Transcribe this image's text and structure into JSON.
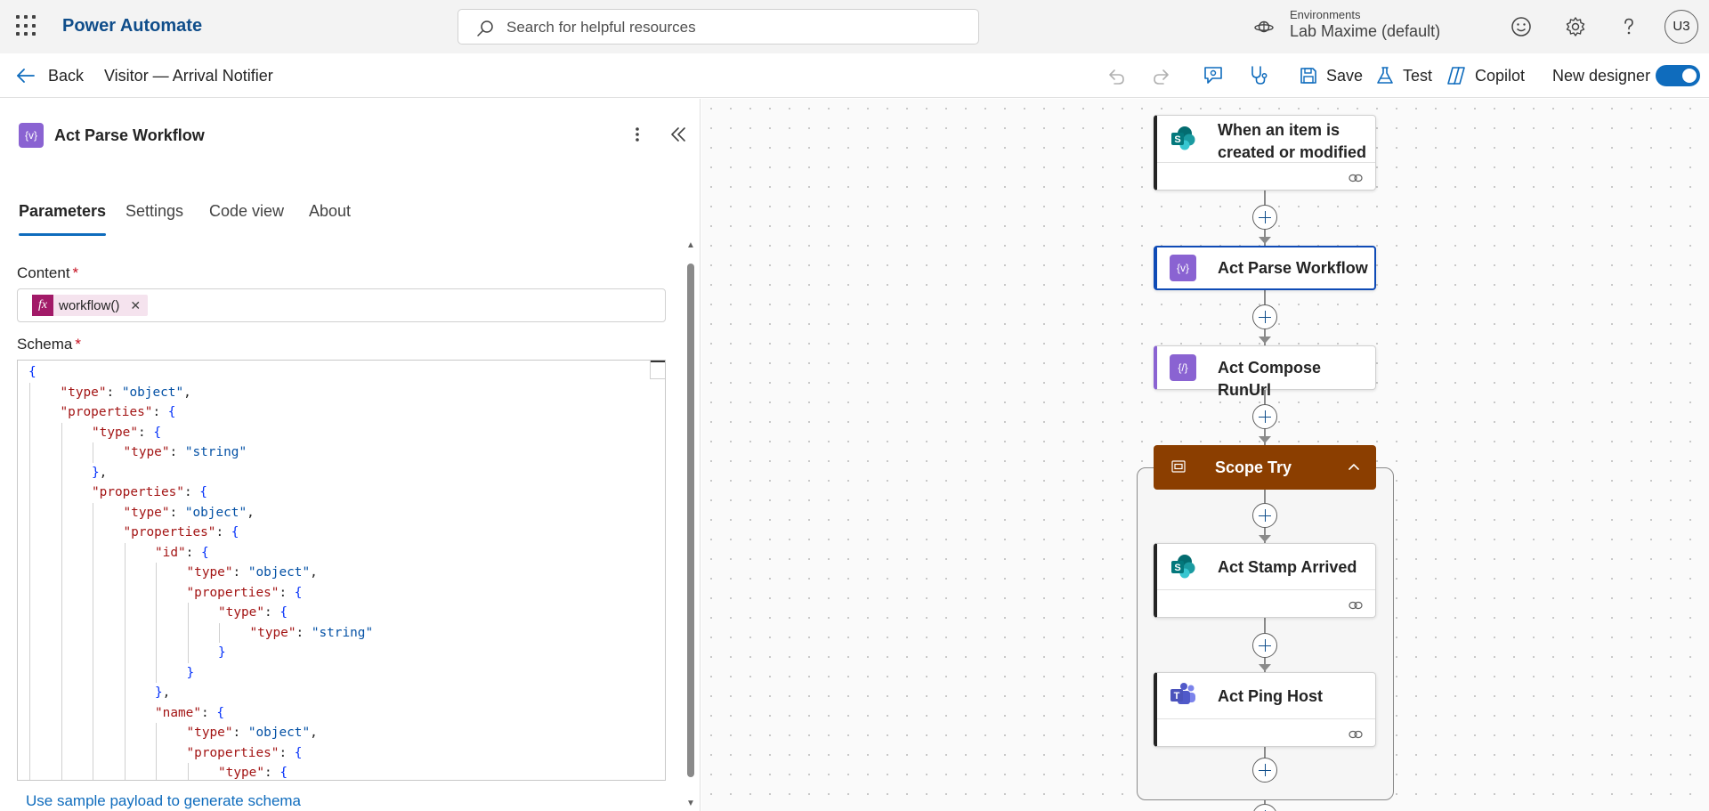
{
  "app": {
    "brand": "Power Automate"
  },
  "search": {
    "placeholder": "Search for helpful resources"
  },
  "environment": {
    "label": "Environments",
    "name": "Lab Maxime (default)"
  },
  "user": {
    "initials": "U3"
  },
  "toolbar": {
    "back_label": "Back",
    "flow_name": "Visitor — Arrival Notifier",
    "save_label": "Save",
    "test_label": "Test",
    "copilot_label": "Copilot",
    "new_designer_label": "New designer",
    "new_designer_on": true
  },
  "panel": {
    "title": "Act Parse Workflow",
    "action_icon": "variable-braces-icon",
    "tabs": [
      {
        "label": "Parameters",
        "active": true
      },
      {
        "label": "Settings",
        "active": false
      },
      {
        "label": "Code view",
        "active": false
      },
      {
        "label": "About",
        "active": false
      }
    ],
    "content_label": "Content",
    "content_required": "*",
    "content_token": "workflow()",
    "schema_label": "Schema",
    "schema_required": "*",
    "schema_lines": [
      {
        "indent": 0,
        "parts": [
          [
            "b",
            "{"
          ]
        ]
      },
      {
        "indent": 1,
        "parts": [
          [
            "k",
            "\"type\""
          ],
          [
            "p",
            ": "
          ],
          [
            "s",
            "\"object\""
          ],
          [
            "p",
            ","
          ]
        ]
      },
      {
        "indent": 1,
        "parts": [
          [
            "k",
            "\"properties\""
          ],
          [
            "p",
            ": "
          ],
          [
            "b",
            "{"
          ]
        ]
      },
      {
        "indent": 2,
        "parts": [
          [
            "k",
            "\"type\""
          ],
          [
            "p",
            ": "
          ],
          [
            "b",
            "{"
          ]
        ]
      },
      {
        "indent": 3,
        "parts": [
          [
            "k",
            "\"type\""
          ],
          [
            "p",
            ": "
          ],
          [
            "s",
            "\"string\""
          ]
        ]
      },
      {
        "indent": 2,
        "parts": [
          [
            "b",
            "}"
          ],
          [
            "p",
            ","
          ]
        ]
      },
      {
        "indent": 2,
        "parts": [
          [
            "k",
            "\"properties\""
          ],
          [
            "p",
            ": "
          ],
          [
            "b",
            "{"
          ]
        ]
      },
      {
        "indent": 3,
        "parts": [
          [
            "k",
            "\"type\""
          ],
          [
            "p",
            ": "
          ],
          [
            "s",
            "\"object\""
          ],
          [
            "p",
            ","
          ]
        ]
      },
      {
        "indent": 3,
        "parts": [
          [
            "k",
            "\"properties\""
          ],
          [
            "p",
            ": "
          ],
          [
            "b",
            "{"
          ]
        ]
      },
      {
        "indent": 4,
        "parts": [
          [
            "k",
            "\"id\""
          ],
          [
            "p",
            ": "
          ],
          [
            "b",
            "{"
          ]
        ]
      },
      {
        "indent": 5,
        "parts": [
          [
            "k",
            "\"type\""
          ],
          [
            "p",
            ": "
          ],
          [
            "s",
            "\"object\""
          ],
          [
            "p",
            ","
          ]
        ]
      },
      {
        "indent": 5,
        "parts": [
          [
            "k",
            "\"properties\""
          ],
          [
            "p",
            ": "
          ],
          [
            "b",
            "{"
          ]
        ]
      },
      {
        "indent": 6,
        "parts": [
          [
            "k",
            "\"type\""
          ],
          [
            "p",
            ": "
          ],
          [
            "b",
            "{"
          ]
        ]
      },
      {
        "indent": 7,
        "parts": [
          [
            "k",
            "\"type\""
          ],
          [
            "p",
            ": "
          ],
          [
            "s",
            "\"string\""
          ]
        ]
      },
      {
        "indent": 6,
        "parts": [
          [
            "b",
            "}"
          ]
        ]
      },
      {
        "indent": 5,
        "parts": [
          [
            "b",
            "}"
          ]
        ]
      },
      {
        "indent": 4,
        "parts": [
          [
            "b",
            "}"
          ],
          [
            "p",
            ","
          ]
        ]
      },
      {
        "indent": 4,
        "parts": [
          [
            "k",
            "\"name\""
          ],
          [
            "p",
            ": "
          ],
          [
            "b",
            "{"
          ]
        ]
      },
      {
        "indent": 5,
        "parts": [
          [
            "k",
            "\"type\""
          ],
          [
            "p",
            ": "
          ],
          [
            "s",
            "\"object\""
          ],
          [
            "p",
            ","
          ]
        ]
      },
      {
        "indent": 5,
        "parts": [
          [
            "k",
            "\"properties\""
          ],
          [
            "p",
            ": "
          ],
          [
            "b",
            "{"
          ]
        ]
      },
      {
        "indent": 6,
        "parts": [
          [
            "k",
            "\"type\""
          ],
          [
            "p",
            ": "
          ],
          [
            "b",
            "{"
          ]
        ]
      }
    ],
    "sample_link": "Use sample payload to generate schema"
  },
  "canvas": {
    "trigger_title": "When an item is created or modified",
    "trigger_icon": "sharepoint-icon",
    "parse_title": "Act Parse Workflow",
    "compose_title": "Act Compose RunUrl",
    "scope_title": "Scope Try",
    "stamp_title": "Act Stamp Arrived",
    "stamp_icon": "sharepoint-icon",
    "ping_title": "Act Ping Host",
    "ping_icon": "teams-icon",
    "colors": {
      "scope": "#8b3e00",
      "selected": "#0f4bb6",
      "variable": "#8a63d2",
      "link": "#0f6cbd"
    }
  }
}
